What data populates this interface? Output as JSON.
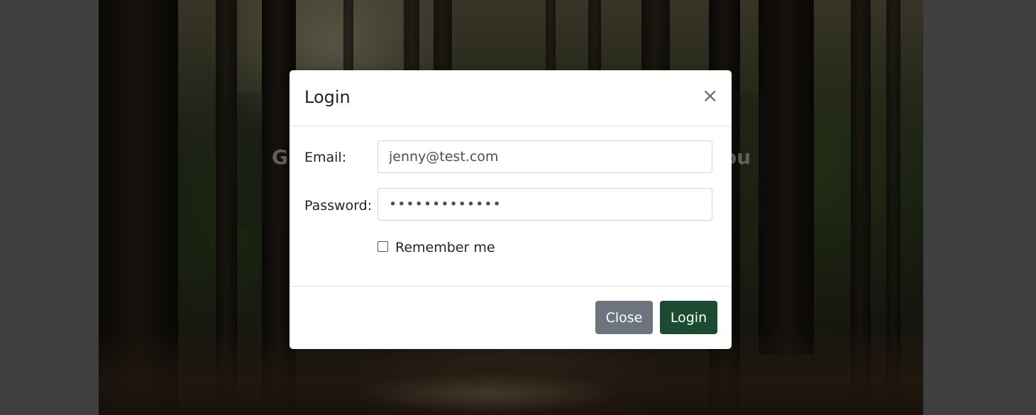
{
  "background": {
    "hero_text_left": "G",
    "hero_text_right": "ou"
  },
  "modal": {
    "title": "Login",
    "close_icon": "×",
    "email_label": "Email:",
    "email_value": "jenny@test.com",
    "password_label": "Password:",
    "password_value": "•••••••••••••",
    "remember_label": "Remember me",
    "remember_checked": false,
    "close_button": "Close",
    "login_button": "Login"
  },
  "colors": {
    "login_button": "#1b4c32",
    "close_button": "#6c757d"
  }
}
